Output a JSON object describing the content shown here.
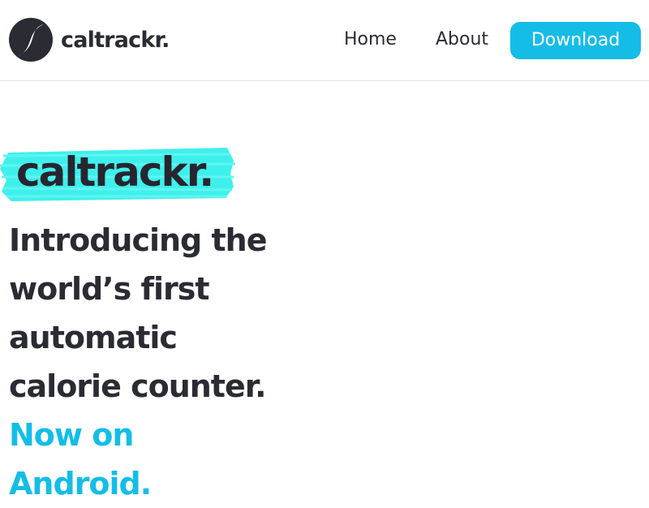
{
  "nav": {
    "brand": "caltrackr.",
    "links": [
      {
        "label": "Home"
      },
      {
        "label": "About"
      }
    ],
    "cta_label": "Download"
  },
  "hero": {
    "brand": "caltrackr.",
    "headline": "Introducing the world’s first automatic calorie counter.",
    "headline_accent": "Now on Android."
  },
  "colors": {
    "accent": "#14bde6",
    "highlight": "#3ef0ec",
    "text": "#2b2b33"
  },
  "icons": {
    "logo": "coffee-bean-icon"
  }
}
